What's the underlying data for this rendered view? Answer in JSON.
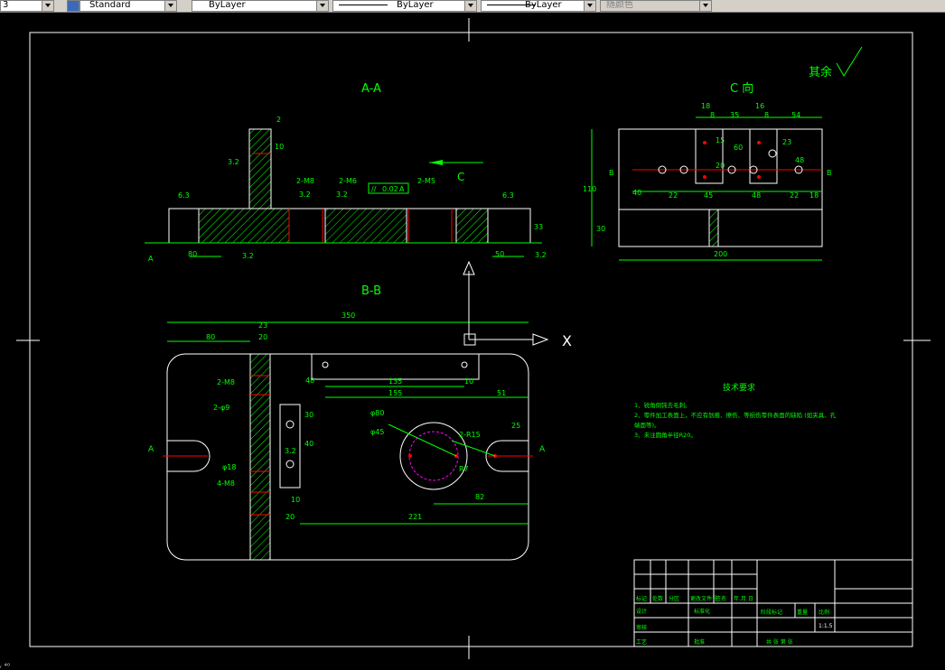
{
  "toolbar": {
    "first_value": "3",
    "text_style": "Standard",
    "layer": "ByLayer",
    "linetype": "ByLayer",
    "lineweight": "ByLayer",
    "color": "随颜色"
  },
  "drawing": {
    "section_aa": "A-A",
    "section_bb": "B-B",
    "view_c": "C 向",
    "roughness_rest": "其余",
    "letter_a": "A",
    "letter_b": "B",
    "letter_c": "C",
    "axis_x": "X",
    "dims_aa": [
      "80",
      "50",
      "33",
      "3.2",
      "6.3",
      "6.3",
      "3.2",
      "3.2",
      "3.2",
      "3.2",
      "2-M8",
      "2-M6",
      "2-M5",
      "//",
      "0.02",
      "A",
      "A",
      "2",
      "10"
    ],
    "dims_bb": [
      "350",
      "23",
      "80",
      "20",
      "2-M8",
      "2-φ9",
      "48",
      "135",
      "155",
      "10",
      "51",
      "30",
      "40",
      "φ80",
      "φ45",
      "2-R15",
      "R7",
      "25",
      "82",
      "221",
      "20",
      "10",
      "4-M8",
      "φ18",
      "3.2"
    ],
    "dims_c": [
      "18",
      "8",
      "35",
      "16",
      "8",
      "54",
      "15",
      "20",
      "60",
      "23",
      "48",
      "110",
      "40",
      "22",
      "45",
      "48",
      "22",
      "18",
      "30",
      "200",
      "B",
      "B"
    ],
    "tech_title": "技术要求",
    "tech_lines": [
      "1、锐角倒钝去毛刺。",
      "2、零件加工表面上，不应有划痕、擦伤、等损伤零件表面的缺陷 (如夹具、孔",
      "端面等)。",
      "3、未注圆角半径R20。"
    ]
  },
  "title_block": {
    "r1": [
      "标记",
      "处数",
      "分区",
      "更改文件号",
      "签名",
      "年.月.日"
    ],
    "design": "设计",
    "standard": "标准化",
    "review": "审核",
    "process": "工艺",
    "approve": "批准",
    "stage": "阶段标记",
    "weight": "重量",
    "scale_label": "比例",
    "scale": "1:1.5",
    "sheets": "共  张   第  张"
  },
  "command": {
    "text": "ᵣ  ⁴⁰"
  }
}
